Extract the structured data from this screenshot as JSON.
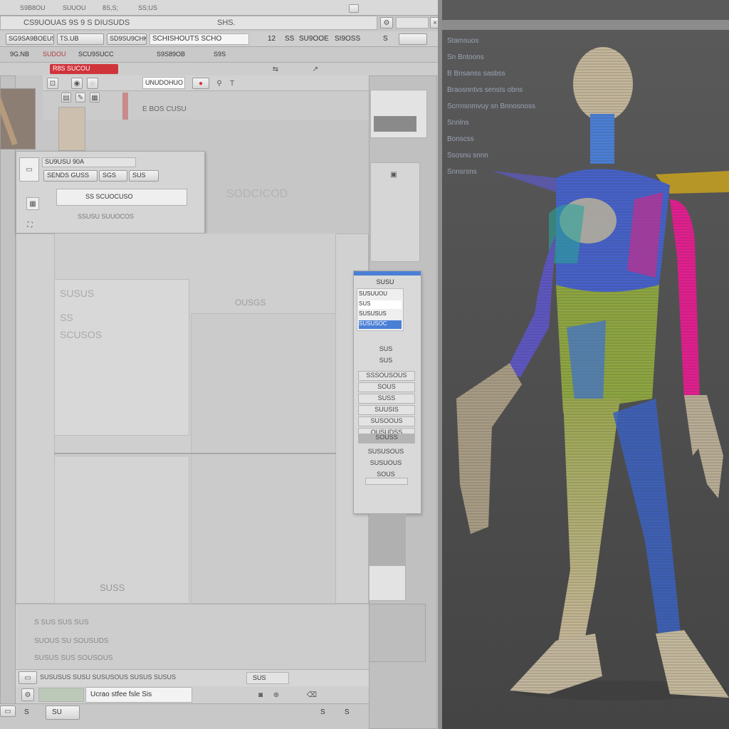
{
  "window": {
    "menu": [
      "S9B8OU",
      "SUUOU",
      "8S,S;",
      "SS;US"
    ],
    "title_path": "CS9UOUAS 9S 9 S DIUSUDS",
    "title_tag": "SHS."
  },
  "toolbar": {
    "tabs": [
      "SG9SA9BOEUS",
      "TS.UB",
      "SD9SU9CHK",
      "S9S"
    ],
    "path_field": "SCHISHOUTS SCHO",
    "readouts": [
      "12",
      "SS",
      "SU9OOE",
      "SI9OSS",
      "S"
    ]
  },
  "ribbon": {
    "labels": [
      "9G.NB",
      "SUDOU",
      "SCU9SUCC",
      "S9S89OB",
      "S9S"
    ],
    "red_tag": "R8S SUCOU",
    "field_value": "UNUDOHUO",
    "sub_label": "E BOS CUSU"
  },
  "dialog": {
    "title": "SU9USU 90A",
    "tab_labels": [
      "SENDS GUSS",
      "SGS",
      "SUS"
    ],
    "field_text": "SS SCUOCUSO",
    "row_text": "SSUSU SUUOCOS"
  },
  "canvas_labels": [
    "SUSUS",
    "SS",
    "SCUSOS",
    "SODCICOD",
    "OUSGS",
    "SUSS"
  ],
  "right_panel": {
    "header": "SUSU",
    "list_items": [
      {
        "label": "SUSUUOU",
        "selected": false
      },
      {
        "label": "SUS",
        "selected": true
      },
      {
        "label": "SUSUSUS",
        "selected": false
      },
      {
        "label": "SUSUSOC",
        "selected": true
      }
    ],
    "props": [
      "SUS",
      "SUS",
      "SSSOUSOUS",
      "SOUS",
      "SUSS",
      "SUUSIS",
      "SUSOOUS",
      "OUSUDSS",
      "SOUSS",
      "SUSUSOUS",
      "SUSUOUS",
      "SOUS"
    ]
  },
  "bottom": {
    "info_lines": [
      "S SUS SUS SUS",
      "SUOUS SU SOUSUDS",
      "SUSUS SUS SOUSOUS"
    ],
    "status_text": "SUSUSUS SUSU SUSUSOUS SUSUS SUSUS",
    "field_text": "Ucrao stfee  fsle Sis",
    "field_label": "SUS",
    "footer": [
      "S",
      "SU",
      "S",
      "S"
    ]
  },
  "viewport": {
    "outliner": [
      "Stamsuos",
      "Sn Bntoons",
      "B Bnsanss sasbss",
      "Braosnntvs sensts obns",
      "Scrrnsnmvuy sn Bnnosnoss",
      "Snnlns",
      "Bonscss",
      "Ssosnu snnn",
      "Snnsrsns"
    ],
    "model_name": "figure-wireframe-model"
  },
  "colors": {
    "viewport_bg": "#4e4e4e",
    "accent_blue": "#4a7fd6",
    "accent_red": "#d0343b",
    "magenta": "#e21e8f",
    "yellow_green": "#a7b64a"
  }
}
